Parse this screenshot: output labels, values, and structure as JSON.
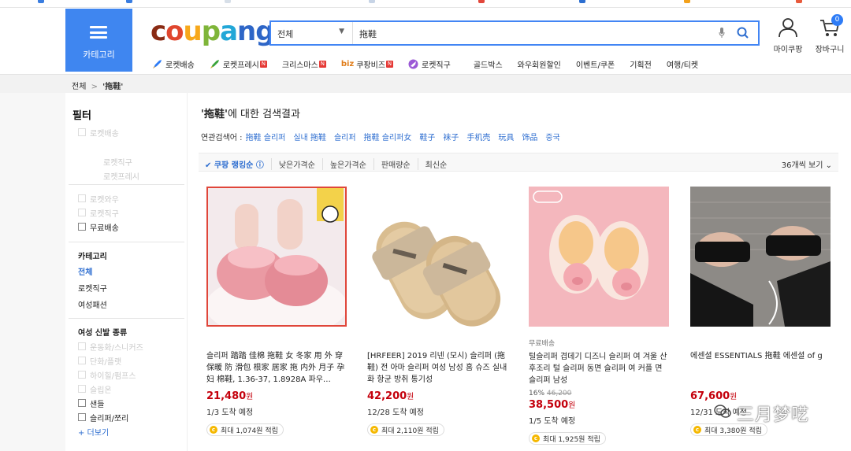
{
  "header": {
    "category_label": "카테고리",
    "logo": "coupang",
    "search_scope": "전체",
    "search_query": "拖鞋",
    "mycoupang_label": "마이쿠팡",
    "cart_label": "장바구니",
    "cart_count": "0"
  },
  "service_nav": [
    {
      "label": "로켓배송",
      "icon": "rocket-icon",
      "badge": ""
    },
    {
      "label": "로켓프레시",
      "icon": "rocket-fresh-icon",
      "badge": "N"
    },
    {
      "label": "크리스마스",
      "icon": "",
      "badge": "N"
    },
    {
      "label": "쿠팡비즈",
      "icon": "biz-icon",
      "badge": "N",
      "prefix": "biz"
    },
    {
      "label": "로켓직구",
      "icon": "global-icon",
      "badge": ""
    },
    {
      "label": "골드박스",
      "icon": "",
      "badge": ""
    },
    {
      "label": "와우회원할인",
      "icon": "",
      "badge": ""
    },
    {
      "label": "이벤트/쿠폰",
      "icon": "",
      "badge": ""
    },
    {
      "label": "기획전",
      "icon": "",
      "badge": ""
    },
    {
      "label": "여행/티켓",
      "icon": "",
      "badge": ""
    }
  ],
  "breadcrumb": {
    "root": "전체",
    "sep": ">",
    "current": "'拖鞋'"
  },
  "sidebar": {
    "title": "필터",
    "faded_top": [
      "로켓배송"
    ],
    "faded_mid": [
      "로켓직구",
      "로켓프레시"
    ],
    "delivery_options": [
      {
        "label": "로켓와우",
        "faded": true
      },
      {
        "label": "로켓직구",
        "faded": true
      },
      {
        "label": "무료배송",
        "faded": false
      }
    ],
    "category_title": "카테고리",
    "categories": [
      {
        "label": "전체",
        "active": true
      },
      {
        "label": "로켓직구",
        "active": false
      },
      {
        "label": "여성패션",
        "active": false
      }
    ],
    "shoe_title": "여성 신발 종류",
    "shoe_types": [
      {
        "label": "운동화/스니커즈",
        "faded": true
      },
      {
        "label": "단화/플랫",
        "faded": true
      },
      {
        "label": "하이힐/펌프스",
        "faded": true
      },
      {
        "label": "슬립온",
        "faded": true
      },
      {
        "label": "샌들",
        "faded": false
      },
      {
        "label": "슬리퍼/쪼리",
        "faded": false
      }
    ],
    "more_label": "+ 더보기"
  },
  "results": {
    "query": "'拖鞋'",
    "title_suffix": "에 대한 검색결과",
    "related_label": "연관검색어 :",
    "related": [
      "拖鞋 슬리퍼",
      "실내 拖鞋",
      "슬리퍼",
      "拖鞋 슬리퍼女",
      "鞋子",
      "袜子",
      "手机壳",
      "玩具",
      "饰品",
      "중국"
    ],
    "sort_options": [
      "✔ 쿠팡 랭킹순 ⓘ",
      "낮은가격순",
      "높은가격순",
      "판매량순",
      "최신순"
    ],
    "view_label": "36개씩 보기 ⌄"
  },
  "products": [
    {
      "name": "슬리퍼 踏踏 佳棉 拖鞋 女 冬家 用 外 穿 保暖 防 滑包 根家 居家 拖 内外 月子 孕妇 棉鞋, 1.36-37, 1.8928A 파우…",
      "free": "",
      "discount_pct": "",
      "orig_price": "",
      "price": "21,480",
      "currency": "원",
      "eta": "1/3 도착 예정",
      "cashback": "최대 1,074원 적립"
    },
    {
      "name": "[HRFEER] 2019 리넨 (모시) 슬리퍼 (拖鞋) 전 아마 슬리퍼 여성 남성 홈 슈즈 실내화 항균 방취 통기성",
      "free": "",
      "discount_pct": "",
      "orig_price": "",
      "price": "42,200",
      "currency": "원",
      "eta": "12/28 도착 예정",
      "cashback": "최대 2,110원 적립"
    },
    {
      "name": "털슬리퍼 겹데기 디즈니 슬리퍼 여 겨울 산후조리 털 슬리퍼 동면 슬리퍼 여 커플 면 슬리퍼 남성",
      "free": "무료배송",
      "discount_pct": "16%",
      "orig_price": "46,200",
      "price": "38,500",
      "currency": "원",
      "eta": "1/5 도착 예정",
      "cashback": "최대 1,925원 적립"
    },
    {
      "name": "에센셜 ESSENTIALS 拖鞋 에센셜 of g",
      "free": "",
      "discount_pct": "",
      "orig_price": "",
      "price": "67,600",
      "currency": "원",
      "eta": "12/31 도착 예정",
      "cashback": "최대 3,380원 적립"
    }
  ],
  "watermark": "三月梦呓",
  "colors": {
    "brand_blue": "#3f86f0",
    "price_red": "#c4000c",
    "link_blue": "#2e6ed0"
  }
}
